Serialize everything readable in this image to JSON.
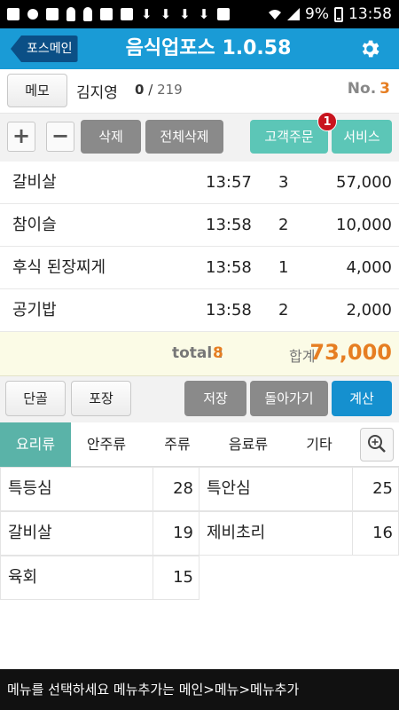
{
  "status_bar": {
    "battery": "9%",
    "time": "13:58"
  },
  "appbar": {
    "back_label": "포스메인",
    "title": "음식업포스 1.0.58",
    "settings_icon": "gear-icon"
  },
  "info": {
    "memo_label": "메모",
    "customer_name": "김지영",
    "count_current": "0",
    "count_separator": "/",
    "count_total": "219",
    "table_label": "No.",
    "table_number": "3"
  },
  "toolbar": {
    "plus": "+",
    "minus": "−",
    "delete_label": "삭제",
    "delete_all_label": "전체삭제",
    "customer_order_label": "고객주문",
    "customer_order_badge": "1",
    "service_label": "서비스"
  },
  "orders": [
    {
      "name": "갈비살",
      "time": "13:57",
      "qty": "3",
      "price": "57,000"
    },
    {
      "name": "참이슬",
      "time": "13:58",
      "qty": "2",
      "price": "10,000"
    },
    {
      "name": "후식 된장찌게",
      "time": "13:58",
      "qty": "1",
      "price": "4,000"
    },
    {
      "name": "공기밥",
      "time": "13:58",
      "qty": "2",
      "price": "2,000"
    }
  ],
  "totals": {
    "total_label": "total :",
    "total_value": "8",
    "sum_label": "합계",
    "sum_value": "73,000"
  },
  "actions": {
    "regular_label": "단골",
    "takeout_label": "포장",
    "save_label": "저장",
    "return_label": "돌아가기",
    "checkout_label": "계산"
  },
  "tabs": [
    {
      "label": "요리류",
      "active": true
    },
    {
      "label": "안주류",
      "active": false
    },
    {
      "label": "주류",
      "active": false
    },
    {
      "label": "음료류",
      "active": false
    },
    {
      "label": "기타",
      "active": false
    }
  ],
  "menu_items": [
    {
      "name": "특등심",
      "qty": "28"
    },
    {
      "name": "특안심",
      "qty": "25"
    },
    {
      "name": "갈비살",
      "qty": "19"
    },
    {
      "name": "제비초리",
      "qty": "16"
    },
    {
      "name": "육회",
      "qty": "15"
    }
  ],
  "bottom_message": "메뉴를 선택하세요 메뉴추가는 메인>메뉴>메뉴추가",
  "colors": {
    "appbar": "#1a9bd6",
    "teal": "#5cc6b7",
    "gray_button": "#8a8a8a",
    "checkout": "#1590cf",
    "accent_orange": "#e67e22",
    "badge_red": "#c8141e"
  }
}
